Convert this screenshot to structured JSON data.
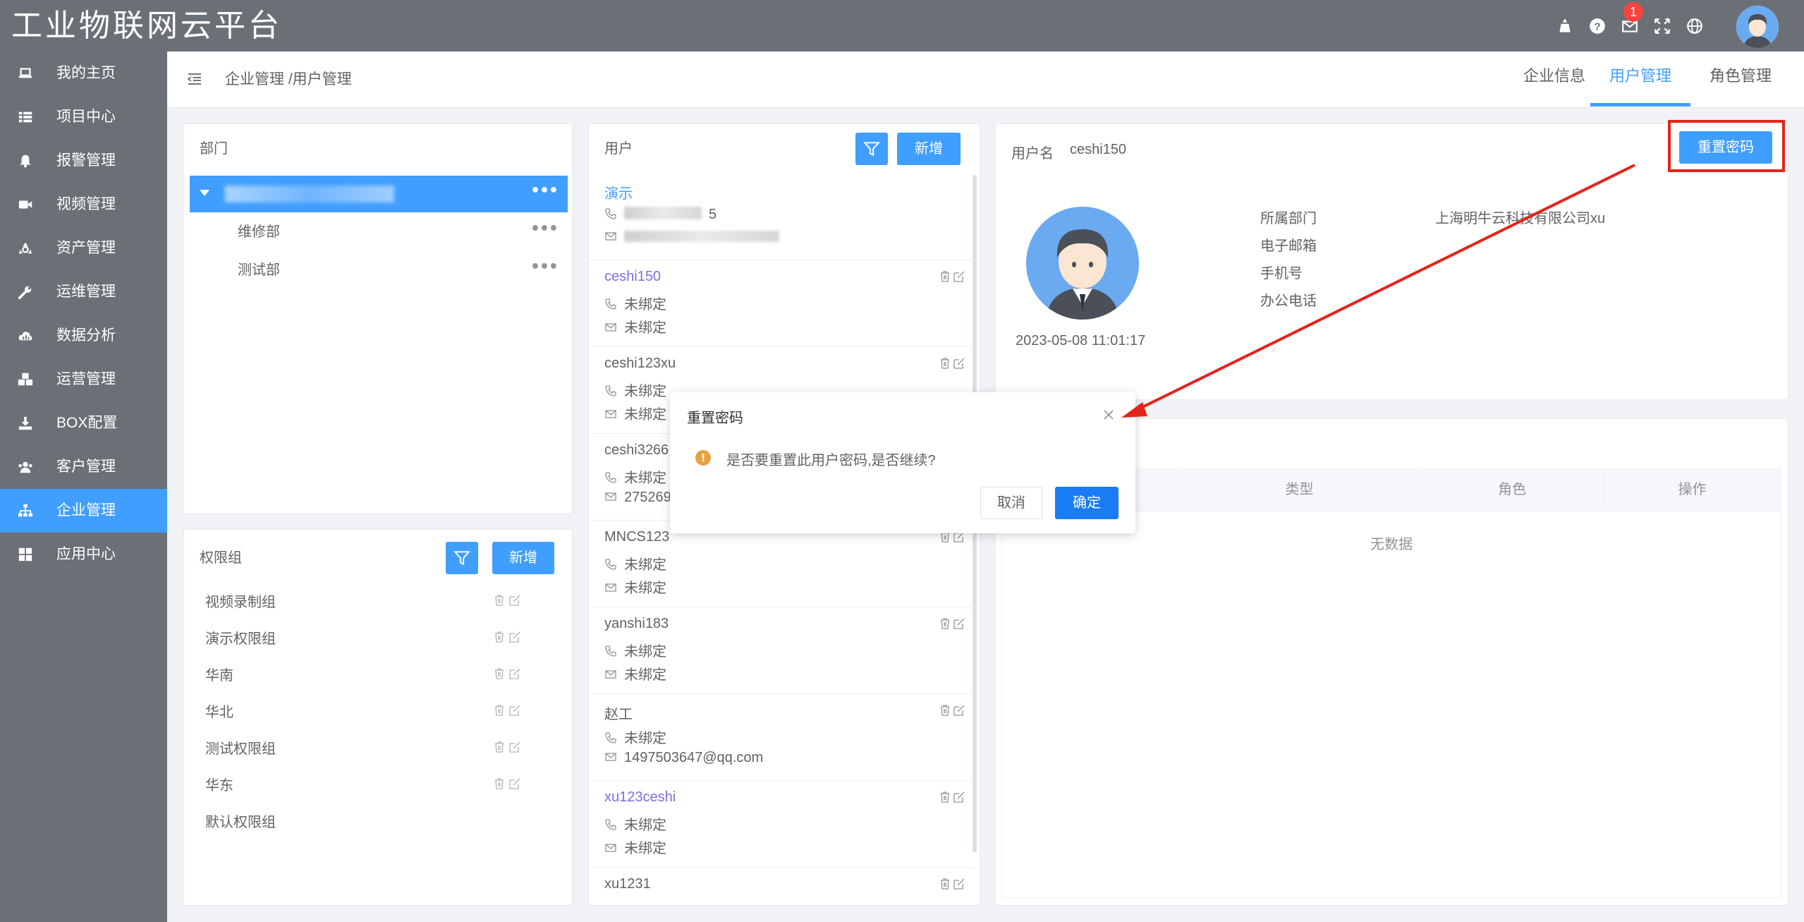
{
  "header": {
    "app_title": "工业物联网云平台",
    "notification_count": "1",
    "icons": [
      "theme-icon",
      "help-icon",
      "mail-icon",
      "fullscreen-icon",
      "language-icon"
    ]
  },
  "sidebar": {
    "items": [
      {
        "label": "我的主页",
        "icon": "laptop-icon"
      },
      {
        "label": "项目中心",
        "icon": "list-icon"
      },
      {
        "label": "报警管理",
        "icon": "bell-icon"
      },
      {
        "label": "视频管理",
        "icon": "video-icon"
      },
      {
        "label": "资产管理",
        "icon": "recycle-icon"
      },
      {
        "label": "运维管理",
        "icon": "wrench-icon"
      },
      {
        "label": "数据分析",
        "icon": "cloud-icon"
      },
      {
        "label": "运营管理",
        "icon": "cubes-icon"
      },
      {
        "label": "BOX配置",
        "icon": "download-icon"
      },
      {
        "label": "客户管理",
        "icon": "users-icon"
      },
      {
        "label": "企业管理",
        "icon": "sitemap-icon"
      },
      {
        "label": "应用中心",
        "icon": "grid-icon"
      }
    ],
    "active_index": 10
  },
  "breadcrumb": "企业管理 /用户管理",
  "tabs": [
    {
      "label": "企业信息"
    },
    {
      "label": "用户管理"
    },
    {
      "label": "角色管理"
    }
  ],
  "dept_panel": {
    "title": "部门",
    "children": [
      "维修部",
      "测试部"
    ]
  },
  "perm_panel": {
    "title": "权限组",
    "add_label": "新增",
    "groups": [
      "视频录制组",
      "演示权限组",
      "华南",
      "华北",
      "测试权限组",
      "华东",
      "默认权限组"
    ]
  },
  "user_panel": {
    "title": "用户",
    "add_label": "新增",
    "users": [
      {
        "name": "演示",
        "phone": "5",
        "email": ""
      },
      {
        "name": "ceshi150",
        "phone": "未绑定",
        "email": "未绑定"
      },
      {
        "name": "ceshi123xu",
        "phone": "未绑定",
        "email": "未绑定"
      },
      {
        "name": "ceshi3266",
        "phone": "未绑定",
        "email": "275269"
      },
      {
        "name": "MNCS123",
        "phone": "未绑定",
        "email": "未绑定"
      },
      {
        "name": "yanshi183",
        "phone": "未绑定",
        "email": "未绑定"
      },
      {
        "name": "赵工",
        "phone": "未绑定",
        "email": "1497503647@qq.com"
      },
      {
        "name": "xu123ceshi",
        "phone": "未绑定",
        "email": "未绑定"
      },
      {
        "name": "xu1231",
        "phone": "",
        "email": ""
      }
    ]
  },
  "detail": {
    "username_label": "用户名",
    "username": "ceshi150",
    "reset_label": "重置密码",
    "created": "2023-05-08 11:01:17",
    "fields": [
      {
        "label": "所属部门",
        "value": "上海明牛云科技有限公司xu"
      },
      {
        "label": "电子邮箱",
        "value": ""
      },
      {
        "label": "手机号",
        "value": ""
      },
      {
        "label": "办公电话",
        "value": ""
      }
    ],
    "table": {
      "columns": [
        "类型",
        "角色",
        "操作"
      ],
      "empty": "无数据"
    }
  },
  "dialog": {
    "title": "重置密码",
    "message": "是否要重置此用户密码,是否继续?",
    "cancel": "取消",
    "confirm": "确定"
  },
  "colors": {
    "primary": "#409eff",
    "header_bg": "#6b7077",
    "annotation_red": "#e3241b",
    "badge_red": "#f5453c",
    "warning": "#e6a23c"
  }
}
